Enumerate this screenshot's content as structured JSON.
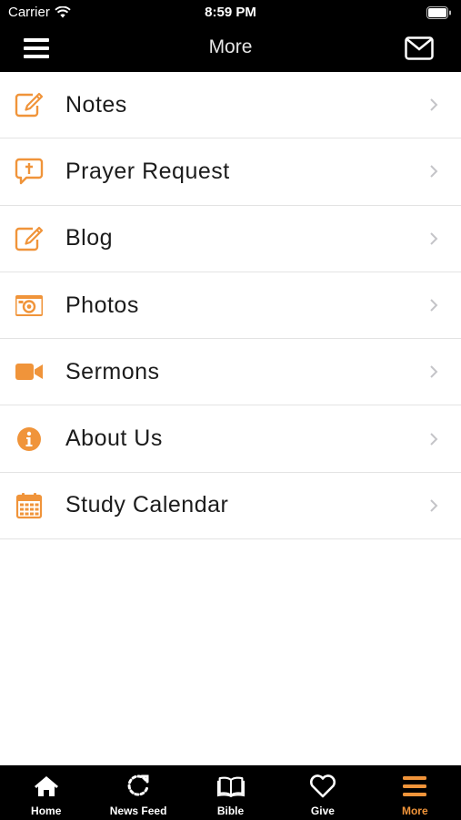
{
  "status": {
    "carrier": "Carrier",
    "time": "8:59 PM"
  },
  "nav": {
    "title": "More",
    "left_icon": "hamburger-icon",
    "right_icon": "mail-icon"
  },
  "accent_color": "#f0943a",
  "menu": [
    {
      "label": "Notes",
      "icon": "edit-icon"
    },
    {
      "label": "Prayer Request",
      "icon": "chat-cross-icon"
    },
    {
      "label": "Blog",
      "icon": "edit-icon"
    },
    {
      "label": "Photos",
      "icon": "camera-icon"
    },
    {
      "label": "Sermons",
      "icon": "video-icon"
    },
    {
      "label": "About Us",
      "icon": "info-icon"
    },
    {
      "label": "Study Calendar",
      "icon": "calendar-icon"
    }
  ],
  "tabs": [
    {
      "label": "Home",
      "icon": "home-icon"
    },
    {
      "label": "News Feed",
      "icon": "refresh-icon"
    },
    {
      "label": "Bible",
      "icon": "book-icon"
    },
    {
      "label": "Give",
      "icon": "heart-icon"
    },
    {
      "label": "More",
      "icon": "menu-icon",
      "active": true
    }
  ]
}
